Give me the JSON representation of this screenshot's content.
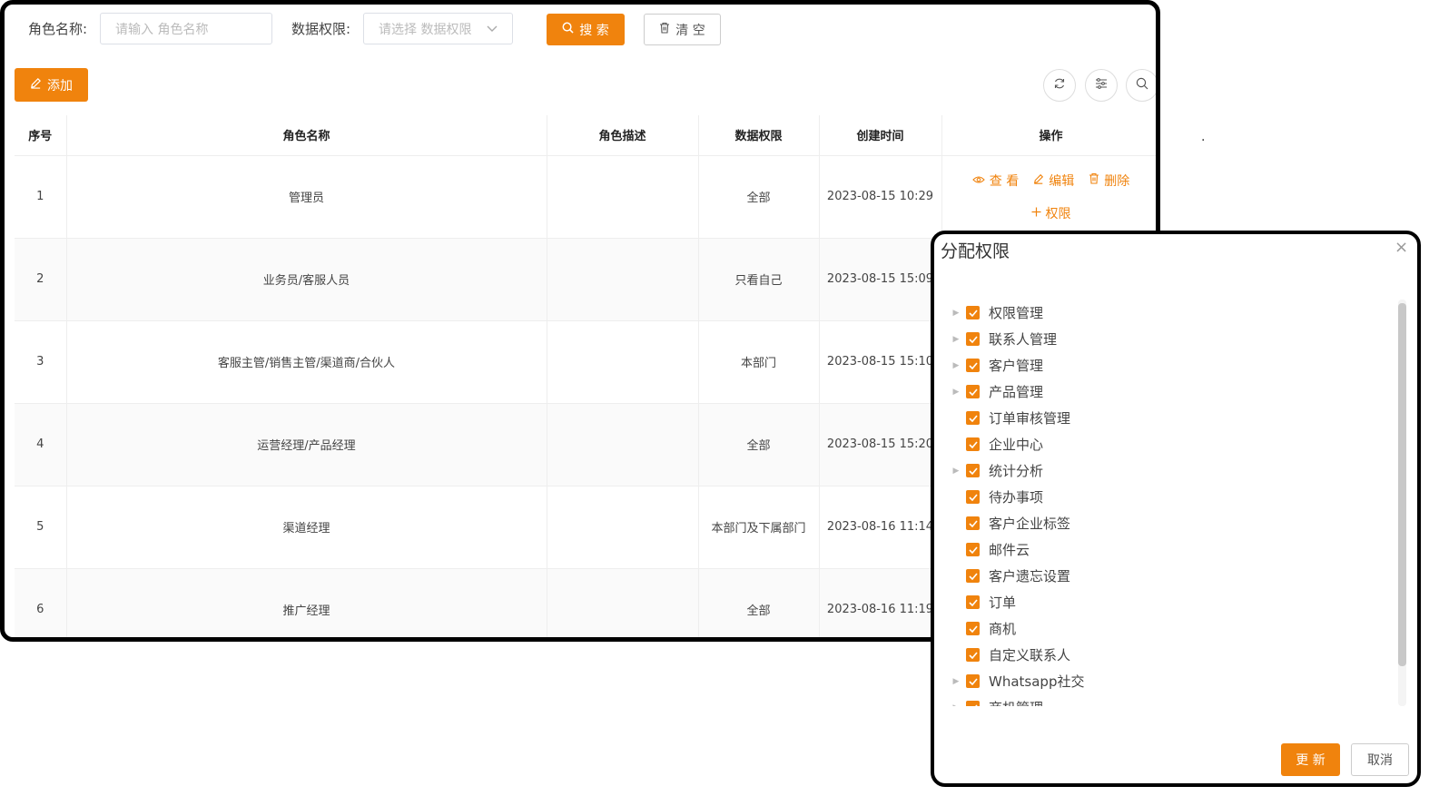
{
  "search": {
    "role_label": "角色名称:",
    "role_placeholder": "请输入 角色名称",
    "perm_label": "数据权限:",
    "perm_placeholder": "请选择 数据权限",
    "search_button": "搜 索",
    "clear_button": "清 空"
  },
  "toolbar": {
    "add_button": "添加"
  },
  "table": {
    "headers": [
      "序号",
      "角色名称",
      "角色描述",
      "数据权限",
      "创建时间",
      "操作"
    ],
    "rows": [
      {
        "index": "1",
        "name": "管理员",
        "desc": "",
        "perm": "全部",
        "created": "2023-08-15 10:29"
      },
      {
        "index": "2",
        "name": "业务员/客服人员",
        "desc": "",
        "perm": "只看自己",
        "created": "2023-08-15 15:09"
      },
      {
        "index": "3",
        "name": "客服主管/销售主管/渠道商/合伙人",
        "desc": "",
        "perm": "本部门",
        "created": "2023-08-15 15:10"
      },
      {
        "index": "4",
        "name": "运营经理/产品经理",
        "desc": "",
        "perm": "全部",
        "created": "2023-08-15 15:20"
      },
      {
        "index": "5",
        "name": "渠道经理",
        "desc": "",
        "perm": "本部门及下属部门",
        "created": "2023-08-16 11:14"
      },
      {
        "index": "6",
        "name": "推广经理",
        "desc": "",
        "perm": "全部",
        "created": "2023-08-16 11:19"
      }
    ],
    "ops": {
      "view": "查 看",
      "edit": "编辑",
      "delete": "删除",
      "permission": "权限"
    }
  },
  "misc": {
    "dot": "."
  },
  "dialog": {
    "title": "分配权限",
    "close": "×",
    "items": [
      {
        "label": "权限管理",
        "expandable": true,
        "checked": true
      },
      {
        "label": "联系人管理",
        "expandable": true,
        "checked": true
      },
      {
        "label": "客户管理",
        "expandable": true,
        "checked": true
      },
      {
        "label": "产品管理",
        "expandable": true,
        "checked": true
      },
      {
        "label": "订单审核管理",
        "expandable": false,
        "checked": true
      },
      {
        "label": "企业中心",
        "expandable": false,
        "checked": true
      },
      {
        "label": "统计分析",
        "expandable": true,
        "checked": true
      },
      {
        "label": "待办事项",
        "expandable": false,
        "checked": true
      },
      {
        "label": "客户企业标签",
        "expandable": false,
        "checked": true
      },
      {
        "label": "邮件云",
        "expandable": false,
        "checked": true
      },
      {
        "label": "客户遗忘设置",
        "expandable": false,
        "checked": true
      },
      {
        "label": "订单",
        "expandable": false,
        "checked": true
      },
      {
        "label": "商机",
        "expandable": false,
        "checked": true
      },
      {
        "label": "自定义联系人",
        "expandable": false,
        "checked": true
      },
      {
        "label": "Whatsapp社交",
        "expandable": true,
        "checked": true
      },
      {
        "label": "商机管理",
        "expandable": true,
        "checked": true
      }
    ],
    "update_button": "更 新",
    "cancel_button": "取消"
  },
  "colors": {
    "accent": "#f0830d",
    "border": "#eeeeee"
  }
}
